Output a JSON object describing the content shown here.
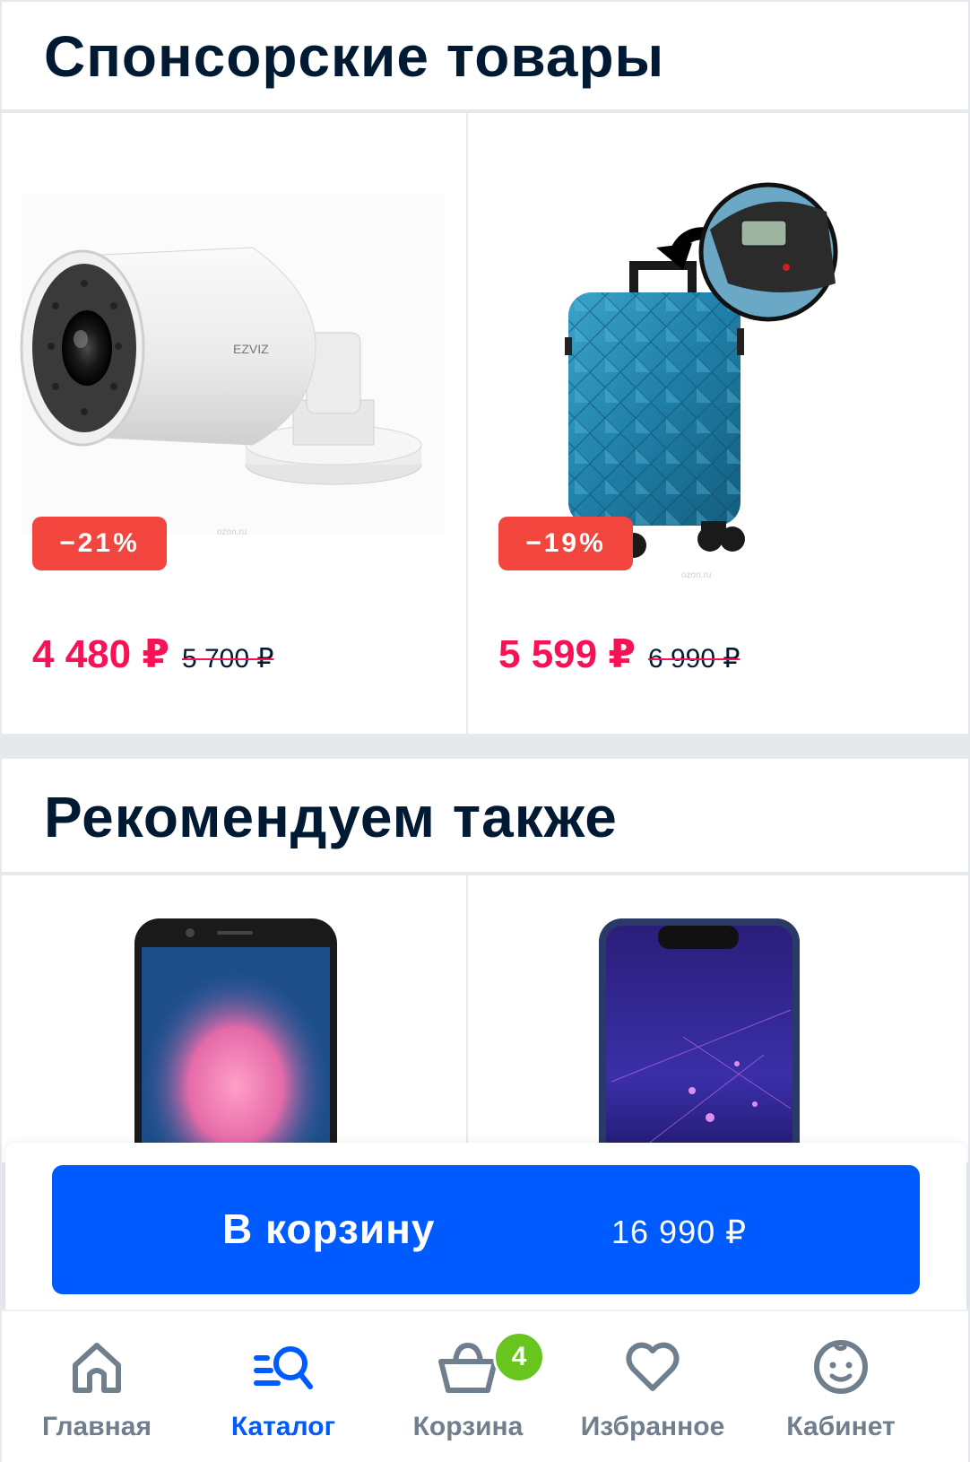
{
  "sponsored": {
    "title": "Спонсорские товары",
    "products": [
      {
        "name": "ezviz-camera",
        "brand": "EZVIZ",
        "watermark": "ozon.ru",
        "discount": "−21%",
        "price": "4 480 ₽",
        "old_price": "5 700 ₽"
      },
      {
        "name": "suitcase",
        "watermark": "ozon.ru",
        "discount": "−19%",
        "price": "5 599 ₽",
        "old_price": "6 990 ₽"
      }
    ]
  },
  "recommended": {
    "title": "Рекомендуем также"
  },
  "cart_cta": {
    "label": "В корзину",
    "price": "16 990 ₽"
  },
  "nav": {
    "items": [
      {
        "label": "Главная",
        "icon": "home-icon"
      },
      {
        "label": "Каталог",
        "icon": "catalog-search-icon",
        "active": true
      },
      {
        "label": "Корзина",
        "icon": "basket-icon",
        "badge": "4"
      },
      {
        "label": "Избранное",
        "icon": "heart-icon"
      },
      {
        "label": "Кабинет",
        "icon": "profile-icon"
      }
    ]
  },
  "colors": {
    "accent": "#005bff",
    "price": "#f91155",
    "discount_badge": "#f1453d",
    "cart_badge": "#67c51e",
    "text": "#001a34",
    "nav_inactive": "#707f8d"
  }
}
